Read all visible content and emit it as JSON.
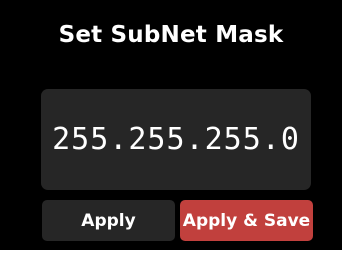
{
  "title": "Set SubNet Mask",
  "subnet_mask": "255.255.255.0",
  "buttons": {
    "apply_label": "Apply",
    "apply_save_label": "Apply & Save"
  },
  "colors": {
    "background": "#000000",
    "field": "#262626",
    "apply_button": "#262626",
    "apply_save_button": "#c1403d",
    "text": "#ffffff"
  }
}
